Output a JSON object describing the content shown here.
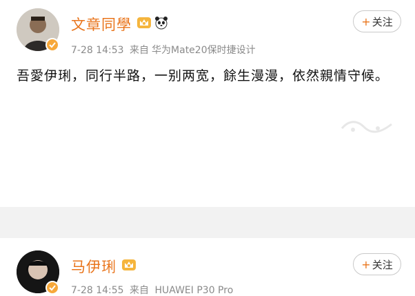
{
  "colors": {
    "username": "#e9741b",
    "meta": "#8a8a8a",
    "separator": "#f2f2f2",
    "badge": "#f7a83a"
  },
  "posts": [
    {
      "username": "文章同學",
      "badges": [
        "vip-crown-icon",
        "panda-icon"
      ],
      "time": "7-28 14:53",
      "source_prefix": "来自",
      "source": "华为Mate20保时捷设计",
      "follow_plus": "+",
      "follow_label": "关注",
      "content": "吾愛伊琍，同行半路，一别两宽，餘生漫漫，依然親情守候。"
    },
    {
      "username": "马伊琍",
      "badges": [
        "vip-crown-icon"
      ],
      "time": "7-28 14:55",
      "source_prefix": "来自",
      "source": "HUAWEI P30 Pro",
      "follow_plus": "+",
      "follow_label": "关注"
    }
  ]
}
